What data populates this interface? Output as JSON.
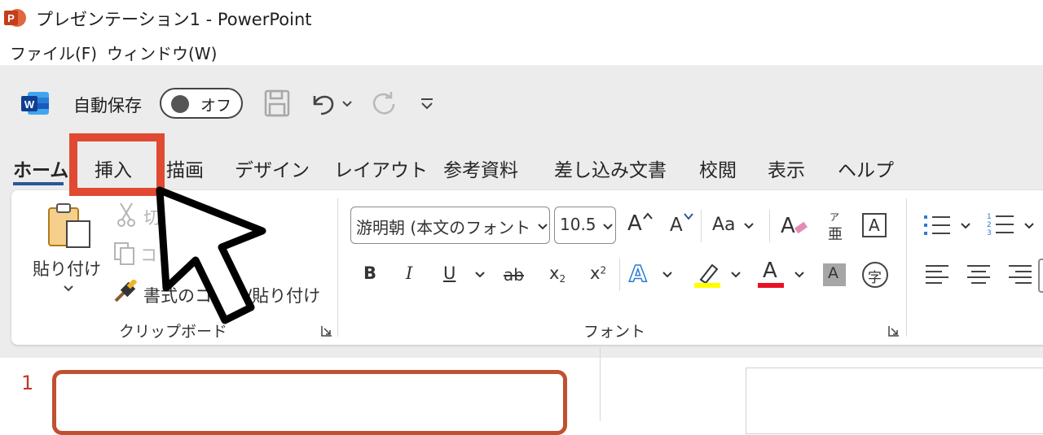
{
  "window": {
    "title": "プレゼンテーション1 - PowerPoint"
  },
  "menu": {
    "file": "ファイル(F)",
    "window": "ウィンドウ(W)"
  },
  "qat": {
    "autosave_label": "自動保存",
    "autosave_state": "オフ"
  },
  "tabs": {
    "home": "ホーム",
    "insert": "挿入",
    "draw": "描画",
    "design": "デザイン",
    "layout": "レイアウト",
    "references": "参考資料",
    "mailings": "差し込み文書",
    "review": "校閲",
    "view": "表示",
    "help": "ヘルプ"
  },
  "clipboard": {
    "paste": "貼り付け",
    "cut": "切",
    "copy": "コピー",
    "format_painter": "書式のコピー/貼り付け",
    "group_label": "クリップボード"
  },
  "font": {
    "name": "游明朝 (本文のフォント",
    "size": "10.5",
    "grow": "A",
    "shrink": "A",
    "change_case": "Aa",
    "phonetic_top": "ア",
    "phonetic_bottom": "亜",
    "char_border": "A",
    "bold": "B",
    "italic": "I",
    "underline": "U",
    "strike": "ab",
    "subscript": "x",
    "subscript_mark": "2",
    "superscript": "x",
    "superscript_mark": "2",
    "text_effects": "A",
    "font_color": "A",
    "char_shading": "A",
    "enclose": "字",
    "group_label": "フォント"
  },
  "slides": {
    "first_number": "1"
  },
  "colors": {
    "highlight": "#e04a32",
    "accent_blue": "#2b579a",
    "highlighter": "#ffff00",
    "font_color": "#e81123",
    "thumb_border": "#c0502f"
  }
}
